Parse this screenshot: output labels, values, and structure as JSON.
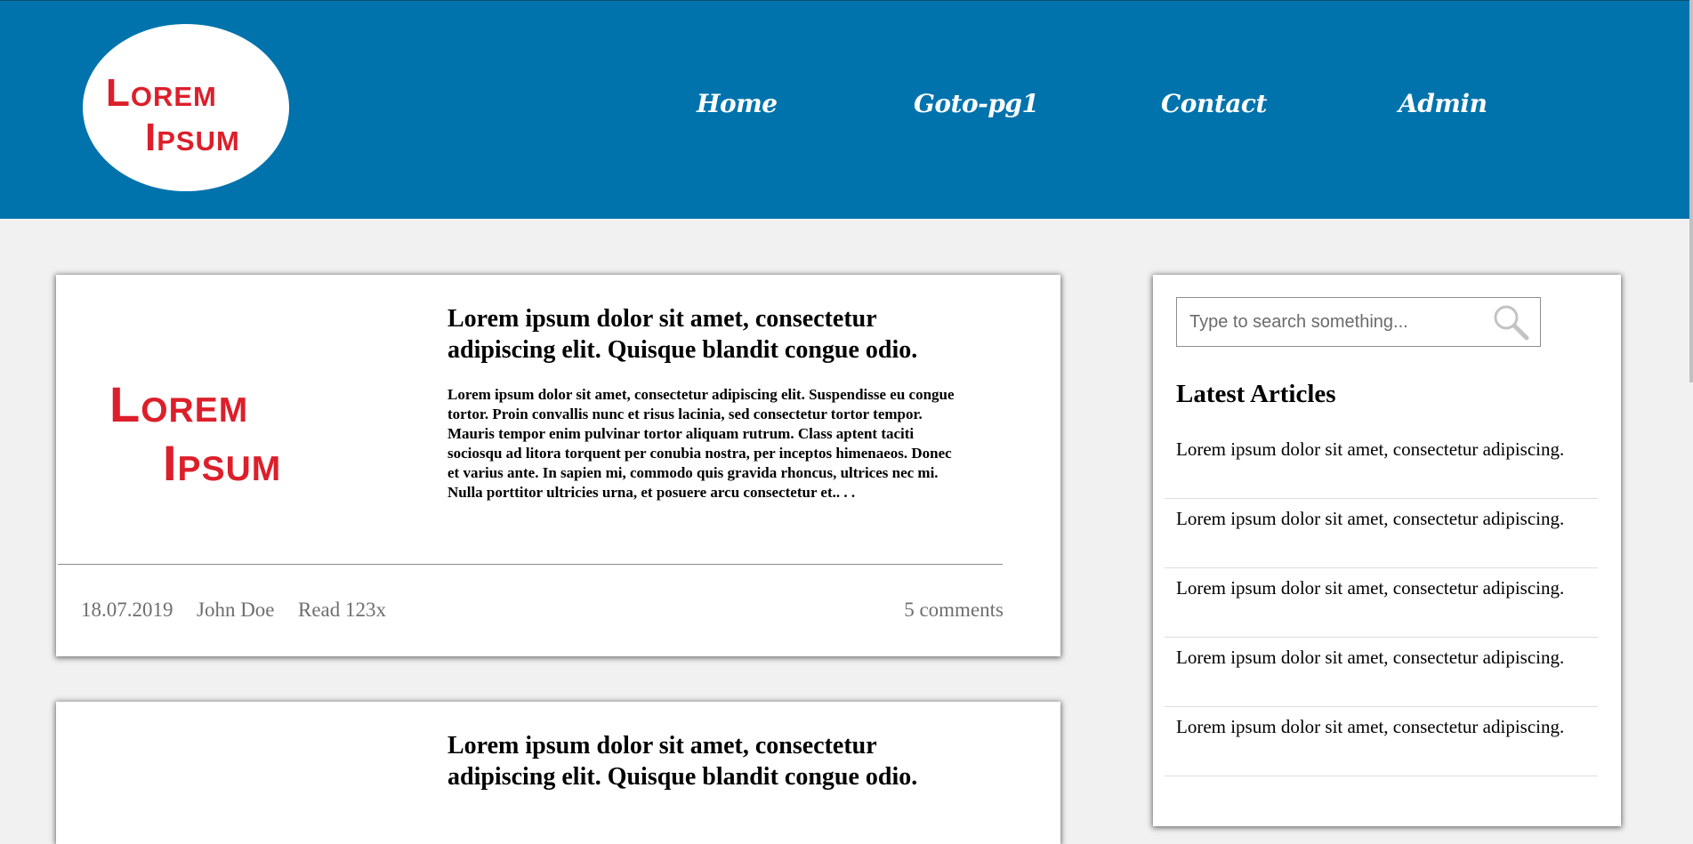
{
  "header": {
    "logo": {
      "line1": "Lorem",
      "line2": "Ipsum"
    },
    "nav": [
      {
        "label": "Home"
      },
      {
        "label": "Goto-pg1"
      },
      {
        "label": "Contact"
      },
      {
        "label": "Admin"
      }
    ]
  },
  "posts": [
    {
      "logo": {
        "line1": "Lorem",
        "line2": "Ipsum"
      },
      "title": "Lorem ipsum dolor sit amet, consectetur adipiscing elit. Quisque blandit congue odio.",
      "excerpt": "Lorem ipsum dolor sit amet, consectetur adipiscing elit. Suspendisse eu congue tortor. Proin convallis nunc et risus lacinia, sed consectetur tortor tempor. Mauris tempor enim pulvinar tortor aliquam rutrum. Class aptent taciti sociosqu ad litora torquent per conubia nostra, per inceptos himenaeos. Donec et varius ante. In sapien mi, commodo quis gravida rhoncus, ultrices nec mi. Nulla porttitor ultricies urna, et posuere arcu consectetur et.. . .",
      "date": "18.07.2019",
      "author": "John Doe",
      "reads": "Read 123x",
      "comments": "5 comments"
    },
    {
      "title": "Lorem ipsum dolor sit amet, consectetur adipiscing elit. Quisque blandit congue odio."
    }
  ],
  "sidebar": {
    "search_placeholder": "Type to search something...",
    "latest_title": "Latest Articles",
    "articles": [
      "Lorem ipsum dolor sit amet, consectetur adipiscing.",
      "Lorem ipsum dolor sit amet, consectetur adipiscing.",
      "Lorem ipsum dolor sit amet, consectetur adipiscing.",
      "Lorem ipsum dolor sit amet, consectetur adipiscing.",
      "Lorem ipsum dolor sit amet, consectetur adipiscing."
    ]
  },
  "colors": {
    "header_bg": "#0073ad",
    "logo_red": "#dc1f2a",
    "page_bg": "#f1f1f1"
  },
  "icons": {
    "search": "magnifier-icon"
  }
}
